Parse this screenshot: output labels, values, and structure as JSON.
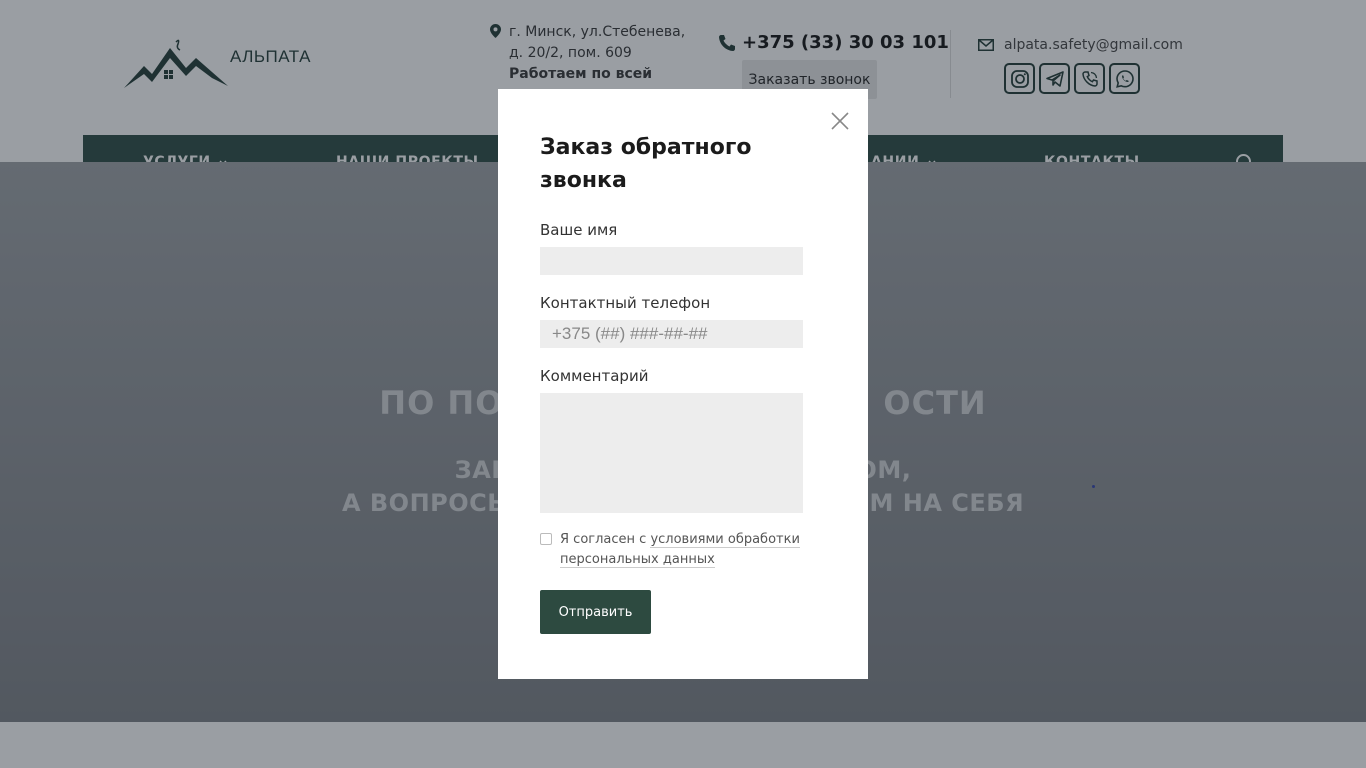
{
  "header": {
    "logo_text": "АЛЬПАТА",
    "address_line1": "г. Минск, ул.Стебенева,",
    "address_line2": "д. 20/2, пом. 609",
    "address_line3": "Работаем по всей",
    "phone": "+375 (33) 30 03 101",
    "callback_label": "Заказать звонок",
    "email": "alpata.safety@gmail.com",
    "socials": [
      "instagram-icon",
      "telegram-icon",
      "viber-icon",
      "whatsapp-icon"
    ]
  },
  "nav": {
    "items": [
      {
        "label": "УСЛУГИ",
        "has_dropdown": true
      },
      {
        "label": "НАШИ ПРОЕКТЫ",
        "has_dropdown": false
      },
      {
        "label": "АНИИ",
        "has_dropdown": true
      },
      {
        "label": "КОНТАКТЫ",
        "has_dropdown": false
      }
    ]
  },
  "hero": {
    "title_left": "ПО ПО",
    "title_right": "ОСТИ",
    "sub_line1_left": "ЗАК",
    "sub_line1_right": "ОМ,",
    "sub_line2_left": "А ВОПРОСЫ",
    "sub_line2_right": "ЁМ НА СЕБЯ"
  },
  "modal": {
    "title": "Заказ обратного звонка",
    "name_label": "Ваше имя",
    "name_value": "",
    "phone_label": "Контактный телефон",
    "phone_placeholder": "+375 (##) ###-##-##",
    "comment_label": "Комментарий",
    "comment_value": "",
    "consent_prefix": "Я согласен с ",
    "consent_link": "условиями обработки персональных данных",
    "submit_label": "Отправить"
  },
  "colors": {
    "brand": "#2b4a42",
    "button": "#2d4a40"
  }
}
